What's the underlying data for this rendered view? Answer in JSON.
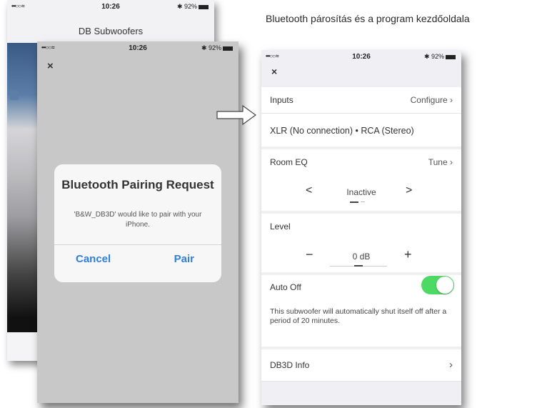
{
  "caption": "Bluetooth párosítás és a program kezdőoldala",
  "status": {
    "carrier": "•••○○ ≈",
    "time": "10:26",
    "battery": "✱ 92%"
  },
  "back_phone": {
    "title": "DB Subwoofers"
  },
  "dialog": {
    "title": "Bluetooth Pairing Request",
    "message": "'B&W_DB3D' would like to pair with your iPhone.",
    "cancel": "Cancel",
    "pair": "Pair"
  },
  "close_glyph": "×",
  "settings": {
    "inputs": {
      "label": "Inputs",
      "action": "Configure ›",
      "value": "XLR (No connection) • RCA (Stereo)"
    },
    "room_eq": {
      "label": "Room EQ",
      "action": "Tune ›",
      "value": "Inactive",
      "prev": "<",
      "next": ">"
    },
    "level": {
      "label": "Level",
      "value": "0 dB",
      "minus": "−",
      "plus": "+"
    },
    "auto_off": {
      "label": "Auto Off",
      "enabled": true,
      "description": "This subwoofer will automatically shut itself off after a period of 20 minutes."
    },
    "info": {
      "label": "DB3D Info",
      "action": "›"
    }
  },
  "colors": {
    "accent": "#2e7fe1",
    "toggle_on": "#4cd964"
  },
  "icons": {
    "arrow": "right-arrow-icon",
    "close": "close-icon"
  }
}
